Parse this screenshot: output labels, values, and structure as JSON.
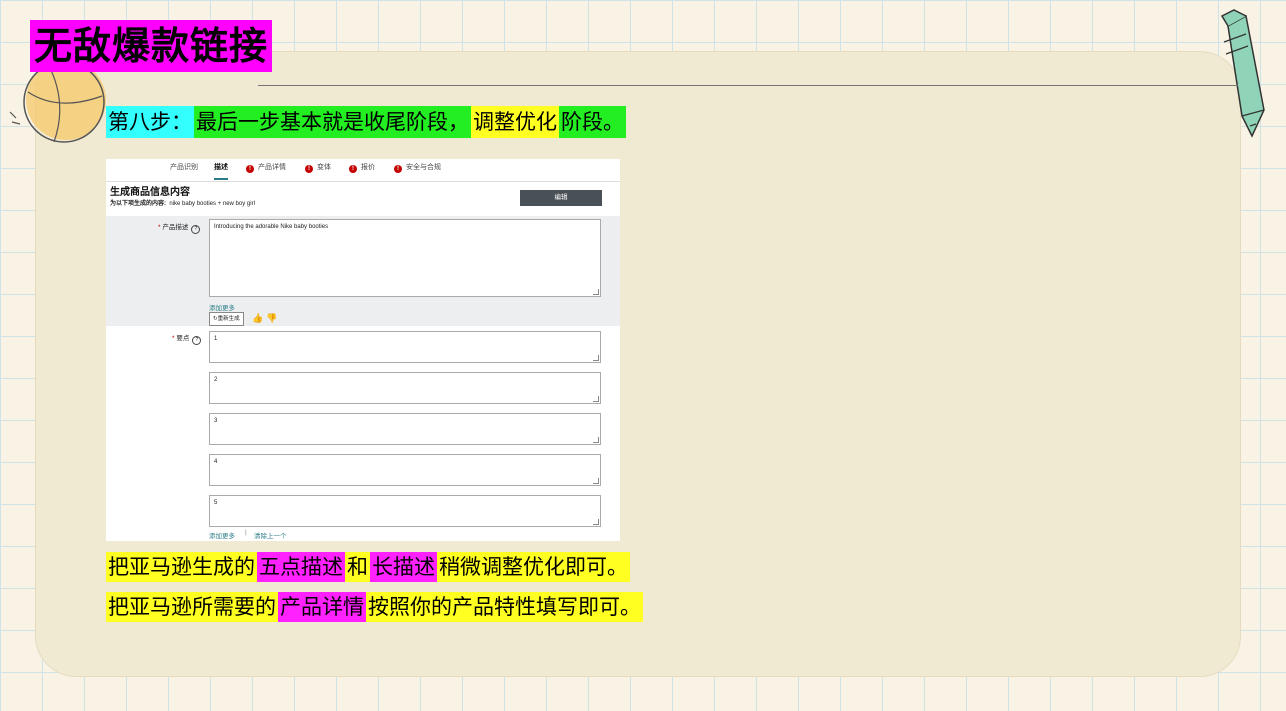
{
  "title": "无敌爆款链接",
  "step": {
    "prefix": "第八步：",
    "part1": "最后一步基本就是收尾阶段，",
    "part2": "调整优化",
    "part3": "阶段。"
  },
  "screenshot": {
    "tabs": [
      {
        "label": "产品识别",
        "warning": false,
        "active": false
      },
      {
        "label": "描述",
        "warning": false,
        "active": true
      },
      {
        "label": "产品详情",
        "warning": true,
        "active": false
      },
      {
        "label": "变体",
        "warning": true,
        "active": false
      },
      {
        "label": "报价",
        "warning": true,
        "active": false
      },
      {
        "label": "安全与合规",
        "warning": true,
        "active": false
      }
    ],
    "section_title": "生成商品信息内容",
    "section_sub_label": "为以下项生成的内容:",
    "section_sub_value": "nike baby booties + new boy girl",
    "edit_button": "编辑",
    "desc_label": "产品描述",
    "desc_value": "Introducing the adorable Nike baby booties",
    "add_more": "添加更多",
    "regenerate": "重新生成",
    "bullets_label": "要点",
    "bullets": [
      "1",
      "2",
      "3",
      "4",
      "5"
    ],
    "add_more_2": "添加更多",
    "separator": "|",
    "clear_last": "清除上一个"
  },
  "line1": {
    "a": "把亚马逊生成的",
    "b": "五点描述",
    "c": "和",
    "d": "长描述",
    "e": "稍微调整优化即可。"
  },
  "line2": {
    "a": "把亚马逊所需要的",
    "b": "产品详情",
    "c": "按照你的产品特性填写即可。"
  }
}
